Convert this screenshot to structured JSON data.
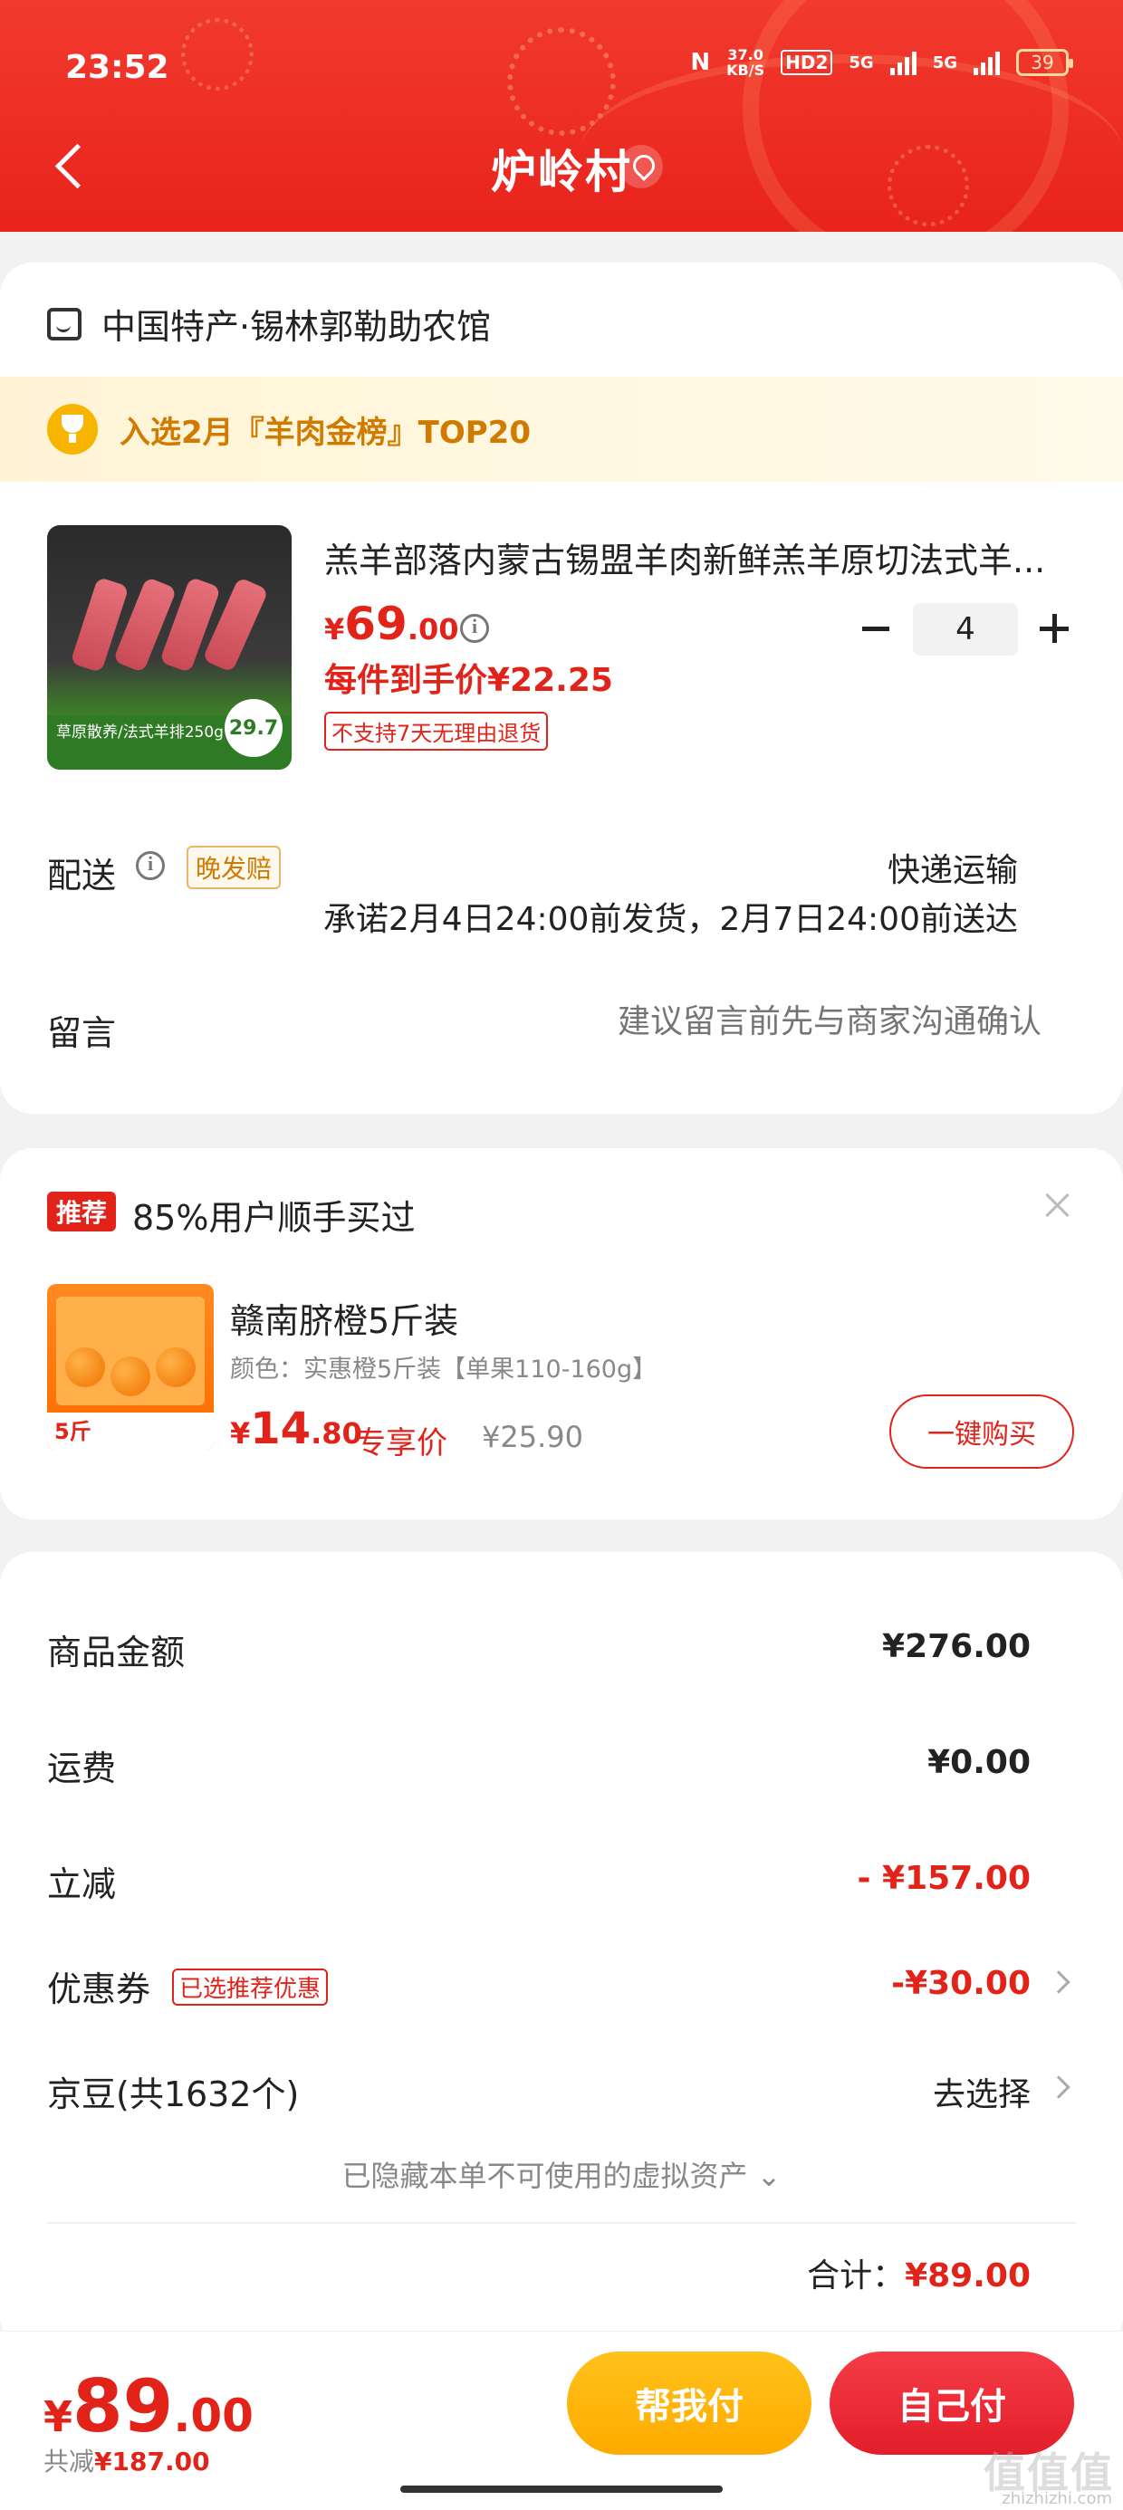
{
  "status_bar": {
    "time": "23:52",
    "speed_value": "37.0",
    "speed_unit": "KB/S",
    "hd": "HD2",
    "net1": "5G",
    "net2": "5G",
    "battery": "39"
  },
  "header": {
    "title": "炉岭村"
  },
  "shop": {
    "name": "中国特产·锡林郭勒助农馆"
  },
  "banner": {
    "text": "入选2月『羊肉金榜』TOP20"
  },
  "product": {
    "title": "羔羊部落内蒙古锡盟羊肉新鲜羔羊原切法式羊...",
    "price_currency": "¥",
    "price_int": "69",
    "price_dec": ".00",
    "quantity": "4",
    "unit_price": "每件到手价¥22.25",
    "no_return": "不支持7天无理由退货",
    "image_tag_line1": "草原散养/法式羊排250g",
    "image_badge": "29.7"
  },
  "delivery": {
    "label": "配送",
    "badge": "晚发赔",
    "method": "快递运输",
    "promise": "承诺2月4日24:00前发货，2月7日24:00前送达"
  },
  "message": {
    "label": "留言",
    "placeholder": "建议留言前先与商家沟通确认"
  },
  "recommend": {
    "badge": "推荐",
    "title": "85%用户顺手买过",
    "name": "赣南脐橙5斤装",
    "spec": "颜色：实惠橙5斤装【单果110-160g】",
    "price_currency": "¥",
    "price_int": "14",
    "price_dec": ".80",
    "exclusive": "专享价",
    "original": "¥25.90",
    "buy_label": "一键购买",
    "image_label": "5斤"
  },
  "summary": {
    "goods_label": "商品金额",
    "goods_value": "¥276.00",
    "shipping_label": "运费",
    "shipping_value": "¥0.00",
    "discount_label": "立减",
    "discount_value": "- ¥157.00",
    "coupon_label": "优惠券",
    "coupon_badge": "已选推荐优惠",
    "coupon_value": "-¥30.00",
    "beans_label": "京豆(共1632个)",
    "beans_value": "去选择",
    "hidden_note": "已隐藏本单不可使用的虚拟资产 ⌄",
    "total_label": "合计：",
    "total_value": "¥89.00"
  },
  "bottom": {
    "price_currency": "¥",
    "price_int": "89",
    "price_dec": ".00",
    "saved_label": "共减",
    "saved_value": "¥187.00",
    "help_pay": "帮我付",
    "self_pay": "自己付"
  },
  "watermark": {
    "main": "值值值",
    "sub": "zhizhizhi.com"
  },
  "colors": {
    "accent_red": "#e2231a",
    "header_red": "#f23a2e",
    "gold": "#ffaa00"
  }
}
